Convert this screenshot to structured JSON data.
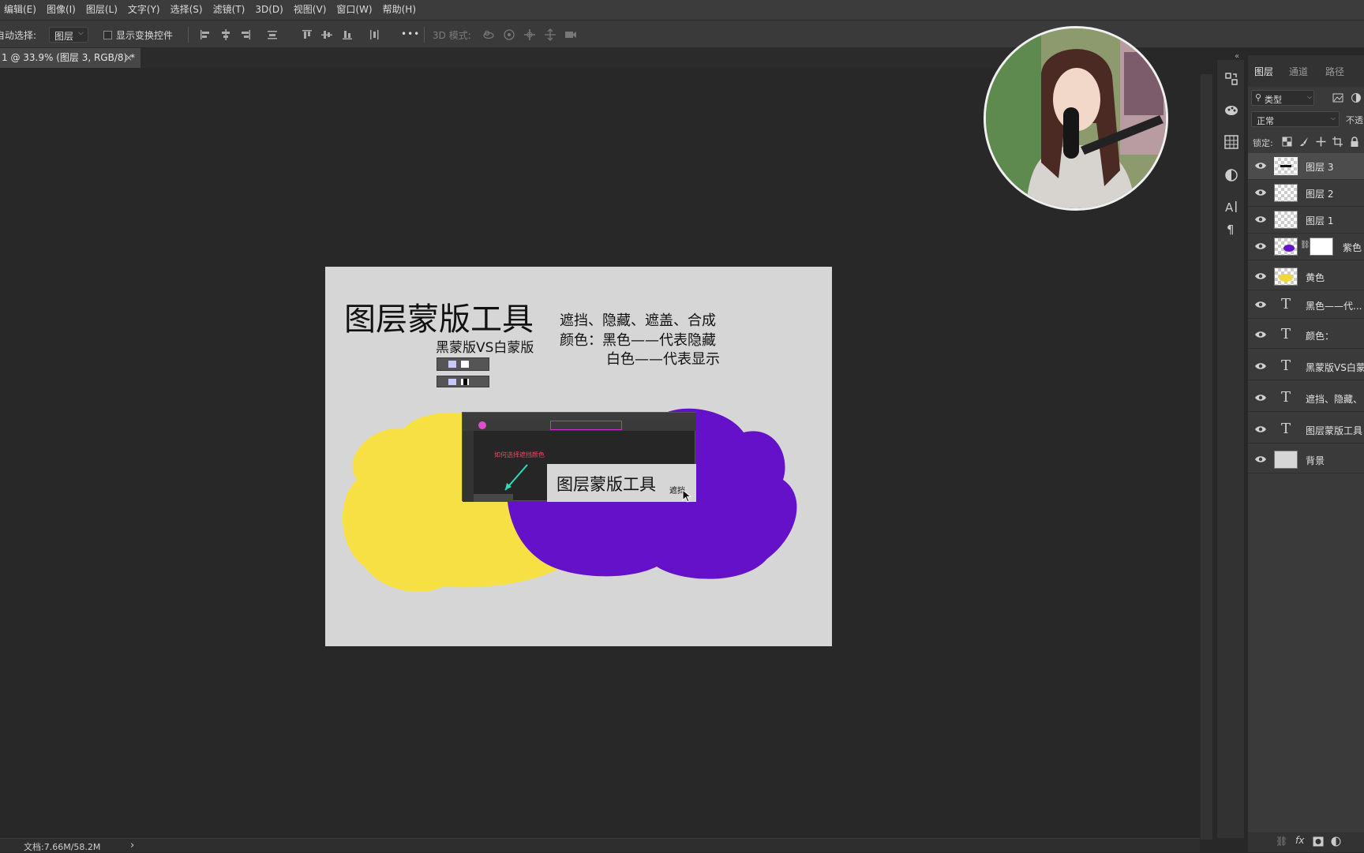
{
  "menubar": {
    "items": [
      "编辑(E)",
      "图像(I)",
      "图层(L)",
      "文字(Y)",
      "选择(S)",
      "滤镜(T)",
      "3D(D)",
      "视图(V)",
      "窗口(W)",
      "帮助(H)"
    ]
  },
  "options": {
    "auto_select_label": "自动选择:",
    "auto_select_value": "图层",
    "show_transform_label": "显示变换控件",
    "mode_3d_label": "3D 模式:",
    "more_label": "•••"
  },
  "document_tab": {
    "title": "1 @ 33.9% (图层 3, RGB/8) *",
    "close": "×"
  },
  "document": {
    "title": "图层蒙版工具",
    "subtitle": "黑蒙版VS白蒙版",
    "line1": "遮挡、隐藏、遮盖、合成",
    "line2": "颜色：黑色——代表隐藏",
    "line3": "白色——代表显示",
    "inset_note": "如何选择遮挡颜色",
    "inset_title": "图层蒙版工具",
    "inset_small": "遮挡",
    "colors": {
      "yellow": "#f6e043",
      "purple": "#6510c9",
      "doc_bg": "#d6d6d6"
    }
  },
  "statusbar": {
    "doc_info": "文档:7.66M/58.2M",
    "arrow": "›"
  },
  "layers_panel": {
    "tabs": [
      "图层",
      "通道",
      "路径"
    ],
    "filter_label": "类型",
    "blend_mode": "正常",
    "opacity_label": "不透",
    "lock_label": "锁定:",
    "layers": [
      {
        "name": "图层 3",
        "kind": "raster",
        "selected": true
      },
      {
        "name": "图层 2",
        "kind": "raster",
        "selected": false
      },
      {
        "name": "图层 1",
        "kind": "raster",
        "selected": false
      },
      {
        "name": "紫色",
        "kind": "masked",
        "selected": false
      },
      {
        "name": "黄色",
        "kind": "yellow",
        "selected": false
      },
      {
        "name": "黑色——代...",
        "kind": "text",
        "selected": false
      },
      {
        "name": "颜色：",
        "kind": "text",
        "selected": false
      },
      {
        "name": "黑蒙版VS白蒙",
        "kind": "text",
        "selected": false
      },
      {
        "name": "遮挡、隐藏、",
        "kind": "text",
        "selected": false
      },
      {
        "name": "图层蒙版工具",
        "kind": "text",
        "selected": false
      },
      {
        "name": "背景",
        "kind": "background",
        "selected": false
      }
    ]
  }
}
